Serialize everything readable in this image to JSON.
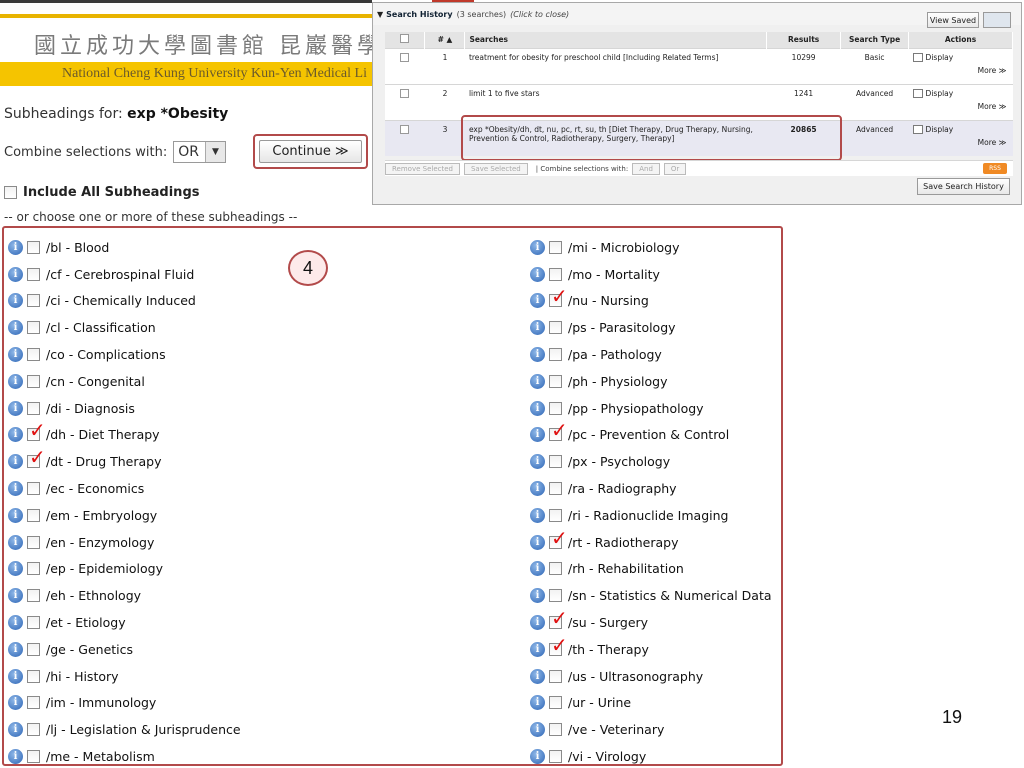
{
  "banner": {
    "chinese_name": "國立成功大學圖書館 昆巖醫學圖書",
    "english_name": "National Cheng Kung University Kun-Yen Medical Li"
  },
  "subheadings": {
    "title_prefix": "Subheadings for:",
    "term": "exp *Obesity",
    "combine_label": "Combine selections with:",
    "combine_value": "OR",
    "continue_label": "Continue ≫",
    "include_all_label": "Include All Subheadings",
    "or_choose_label": "-- or choose one or more of these subheadings --",
    "left_column": [
      {
        "label": "/bl - Blood",
        "checked": false
      },
      {
        "label": "/cf - Cerebrospinal Fluid",
        "checked": false
      },
      {
        "label": "/ci - Chemically Induced",
        "checked": false
      },
      {
        "label": "/cl - Classification",
        "checked": false
      },
      {
        "label": "/co - Complications",
        "checked": false
      },
      {
        "label": "/cn - Congenital",
        "checked": false
      },
      {
        "label": "/di - Diagnosis",
        "checked": false
      },
      {
        "label": "/dh - Diet Therapy",
        "checked": true
      },
      {
        "label": "/dt - Drug Therapy",
        "checked": true
      },
      {
        "label": "/ec - Economics",
        "checked": false
      },
      {
        "label": "/em - Embryology",
        "checked": false
      },
      {
        "label": "/en - Enzymology",
        "checked": false
      },
      {
        "label": "/ep - Epidemiology",
        "checked": false
      },
      {
        "label": "/eh - Ethnology",
        "checked": false
      },
      {
        "label": "/et - Etiology",
        "checked": false
      },
      {
        "label": "/ge - Genetics",
        "checked": false
      },
      {
        "label": "/hi - History",
        "checked": false
      },
      {
        "label": "/im - Immunology",
        "checked": false
      },
      {
        "label": "/lj - Legislation & Jurisprudence",
        "checked": false
      },
      {
        "label": "/me - Metabolism",
        "checked": false
      }
    ],
    "right_column": [
      {
        "label": "/mi - Microbiology",
        "checked": false
      },
      {
        "label": "/mo - Mortality",
        "checked": false
      },
      {
        "label": "/nu - Nursing",
        "checked": true
      },
      {
        "label": "/ps - Parasitology",
        "checked": false
      },
      {
        "label": "/pa - Pathology",
        "checked": false
      },
      {
        "label": "/ph - Physiology",
        "checked": false
      },
      {
        "label": "/pp - Physiopathology",
        "checked": false
      },
      {
        "label": "/pc - Prevention & Control",
        "checked": true
      },
      {
        "label": "/px - Psychology",
        "checked": false
      },
      {
        "label": "/ra - Radiography",
        "checked": false
      },
      {
        "label": "/ri - Radionuclide Imaging",
        "checked": false
      },
      {
        "label": "/rt - Radiotherapy",
        "checked": true
      },
      {
        "label": "/rh - Rehabilitation",
        "checked": false
      },
      {
        "label": "/sn - Statistics & Numerical Data",
        "checked": false
      },
      {
        "label": "/su - Surgery",
        "checked": true
      },
      {
        "label": "/th - Therapy",
        "checked": true
      },
      {
        "label": "/us - Ultrasonography",
        "checked": false
      },
      {
        "label": "/ur - Urine",
        "checked": false
      },
      {
        "label": "/ve - Veterinary",
        "checked": false
      },
      {
        "label": "/vi - Virology",
        "checked": false
      }
    ]
  },
  "step_badge": "4",
  "search_history": {
    "title": "Search History",
    "count": "(3 searches)",
    "click_hint": "(Click to close)",
    "view_saved_label": "View Saved",
    "columns": [
      "",
      "# ▲",
      "Searches",
      "Results",
      "Search Type",
      "Actions"
    ],
    "rows": [
      {
        "num": "1",
        "search": "treatment for obesity for preschool child [Including Related Terms]",
        "results": "10299",
        "type": "Basic",
        "display": "Display",
        "more": "More ≫"
      },
      {
        "num": "2",
        "search": "limit 1 to five stars",
        "results": "1241",
        "type": "Advanced",
        "display": "Display",
        "more": "More ≫"
      },
      {
        "num": "3",
        "search": "exp *Obesity/dh, dt, nu, pc, rt, su, th [Diet Therapy, Drug Therapy, Nursing, Prevention & Control, Radiotherapy, Surgery, Therapy]",
        "results": "20865",
        "type": "Advanced",
        "display": "Display",
        "more": "More ≫"
      }
    ],
    "remove_selected_label": "Remove Selected",
    "save_selected_label": "Save Selected",
    "combine_label": "| Combine selections with:",
    "and_label": "And",
    "or_label": "Or",
    "rss_label": "RSS",
    "save_history_label": "Save Search History"
  },
  "page_number": "19",
  "colors": {
    "highlight_border": "#b24a4a",
    "banner_gold": "#f5c400",
    "check_mark": "#e01010",
    "info_icon": "#2c64b5"
  }
}
